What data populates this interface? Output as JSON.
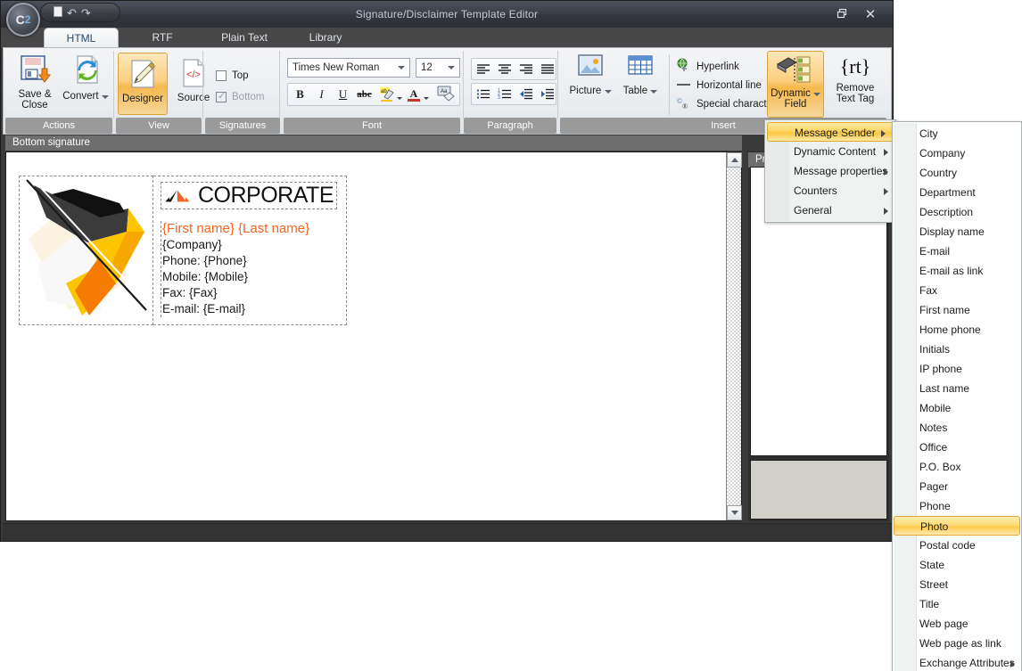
{
  "window": {
    "title": "Signature/Disclaimer Template Editor",
    "orb_label": "C",
    "orb_label_sub": "2",
    "restore_icon": "restore-icon",
    "close_icon": "close-icon"
  },
  "quick_access": {
    "new_icon": "new-document-icon",
    "undo_icon": "undo-icon",
    "redo_icon": "redo-icon",
    "undo_glyph": "↶",
    "redo_glyph": "↷"
  },
  "tabs": [
    {
      "label": "HTML",
      "active": true
    },
    {
      "label": "RTF",
      "active": false
    },
    {
      "label": "Plain Text",
      "active": false
    },
    {
      "label": "Library",
      "active": false
    }
  ],
  "ribbon": {
    "groups": [
      {
        "label": "Actions"
      },
      {
        "label": "View"
      },
      {
        "label": "Signatures"
      },
      {
        "label": "Font"
      },
      {
        "label": "Paragraph"
      },
      {
        "label": "Insert"
      }
    ],
    "actions": {
      "save_close": "Save &\nClose",
      "save_close_line1": "Save &",
      "save_close_line2": "Close",
      "convert": "Convert",
      "convert_has_dropdown": true
    },
    "view": {
      "designer": "Designer",
      "source": "Source",
      "source_glyph": "</>",
      "designer_selected": true
    },
    "signatures": {
      "top_label": "Top",
      "bottom_label": "Bottom",
      "top_checked": false,
      "bottom_checked": true
    },
    "font": {
      "family_value": "Times New Roman",
      "size_value": "12",
      "bold": "B",
      "italic": "I",
      "underline": "U",
      "strikethrough": "abc",
      "highlight": "ab",
      "font_color": "A",
      "clear_format": "Aa"
    },
    "paragraph": {
      "align_left": "align-left-icon",
      "align_center": "align-center-icon",
      "align_right": "align-right-icon",
      "align_justify": "align-justify-icon",
      "bullet_list": "bullet-list-icon",
      "numbered_list": "numbered-list-icon",
      "decrease_indent": "decrease-indent-icon",
      "increase_indent": "increase-indent-icon"
    },
    "insert": {
      "picture": "Picture",
      "table": "Table",
      "hyperlink": "Hyperlink",
      "horizontal_line": "Horizontal line",
      "special_character": "Special character",
      "dynamic_field_line1": "Dynamic",
      "dynamic_field_line2": "Field",
      "remove_tag_line1": "Remove",
      "remove_tag_line2": "Text Tag",
      "remove_tag_glyph": "{rt}",
      "dynamic_field_selected": true
    }
  },
  "editor": {
    "panel_header": "Bottom signature",
    "signature": {
      "logo_alt": "corporate-abstract-logo",
      "brand_word": "CORPORATE",
      "brand_mark": "corporate-tent-logo",
      "lines": [
        {
          "text": "{First name} {Last name}",
          "accent": true
        },
        {
          "text": "{Company}",
          "accent": false
        },
        {
          "text": "Phone: {Phone}",
          "accent": false
        },
        {
          "text": "Mobile: {Mobile}",
          "accent": false
        },
        {
          "text": "Fax: {Fax}",
          "accent": false
        },
        {
          "text": "E-mail: {E-mail}",
          "accent": false
        }
      ]
    }
  },
  "properties_panel": {
    "header": "Pro"
  },
  "menu_dynamic_field": {
    "items": [
      {
        "label": "Message Sender",
        "submenu": true,
        "highlighted": true
      },
      {
        "label": "Dynamic Content",
        "submenu": true,
        "highlighted": false
      },
      {
        "label": "Message properties",
        "submenu": true,
        "highlighted": false
      },
      {
        "label": "Counters",
        "submenu": true,
        "highlighted": false
      },
      {
        "label": "General",
        "submenu": true,
        "highlighted": false
      }
    ]
  },
  "menu_message_sender": {
    "items": [
      {
        "label": "City",
        "submenu": false,
        "highlighted": false
      },
      {
        "label": "Company",
        "submenu": false,
        "highlighted": false
      },
      {
        "label": "Country",
        "submenu": false,
        "highlighted": false
      },
      {
        "label": "Department",
        "submenu": false,
        "highlighted": false
      },
      {
        "label": "Description",
        "submenu": false,
        "highlighted": false
      },
      {
        "label": "Display name",
        "submenu": false,
        "highlighted": false
      },
      {
        "label": "E-mail",
        "submenu": false,
        "highlighted": false
      },
      {
        "label": "E-mail as link",
        "submenu": false,
        "highlighted": false
      },
      {
        "label": "Fax",
        "submenu": false,
        "highlighted": false
      },
      {
        "label": "First name",
        "submenu": false,
        "highlighted": false
      },
      {
        "label": "Home phone",
        "submenu": false,
        "highlighted": false
      },
      {
        "label": "Initials",
        "submenu": false,
        "highlighted": false
      },
      {
        "label": "IP phone",
        "submenu": false,
        "highlighted": false
      },
      {
        "label": "Last name",
        "submenu": false,
        "highlighted": false
      },
      {
        "label": "Mobile",
        "submenu": false,
        "highlighted": false
      },
      {
        "label": "Notes",
        "submenu": false,
        "highlighted": false
      },
      {
        "label": "Office",
        "submenu": false,
        "highlighted": false
      },
      {
        "label": "P.O. Box",
        "submenu": false,
        "highlighted": false
      },
      {
        "label": "Pager",
        "submenu": false,
        "highlighted": false
      },
      {
        "label": "Phone",
        "submenu": false,
        "highlighted": false
      },
      {
        "label": "Photo",
        "submenu": false,
        "highlighted": true
      },
      {
        "label": "Postal code",
        "submenu": false,
        "highlighted": false
      },
      {
        "label": "State",
        "submenu": false,
        "highlighted": false
      },
      {
        "label": "Street",
        "submenu": false,
        "highlighted": false
      },
      {
        "label": "Title",
        "submenu": false,
        "highlighted": false
      },
      {
        "label": "Web page",
        "submenu": false,
        "highlighted": false
      },
      {
        "label": "Web page as link",
        "submenu": false,
        "highlighted": false
      },
      {
        "label": "Exchange Attributes",
        "submenu": true,
        "highlighted": false
      }
    ]
  },
  "colors": {
    "accent_orange": "#f26522",
    "highlight_gold": "#fbc63f",
    "titlebar": "#3d4049",
    "group_label_bg": "#9a9a9a",
    "selected_ribbon": "#f6b94e"
  }
}
